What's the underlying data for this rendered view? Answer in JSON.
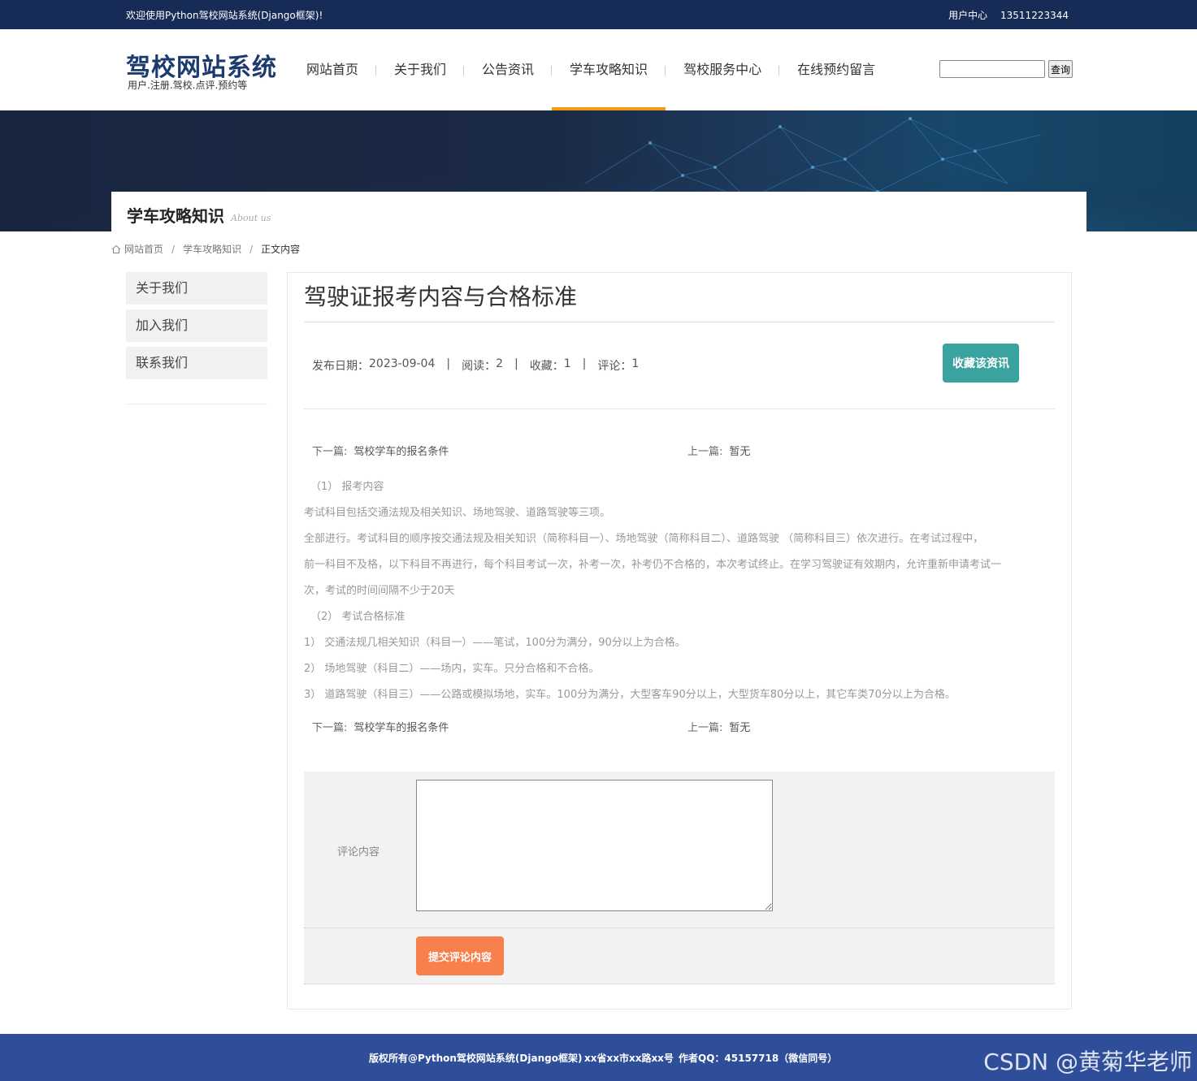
{
  "topbar": {
    "welcome": "欢迎使用Python驾校网站系统(Django框架)!",
    "user_center": "用户中心",
    "phone": "13511223344"
  },
  "header": {
    "logo_title": "驾校网站系统",
    "logo_subtitle": "用户.注册.驾校.点评.预约等",
    "nav": [
      "网站首页",
      "关于我们",
      "公告资讯",
      "学车攻略知识",
      "驾校服务中心",
      "在线预约留言"
    ],
    "active_nav": "学车攻略知识",
    "search_placeholder": "",
    "search_button": "查询"
  },
  "banner": {
    "title": "学车攻略知识",
    "subtitle": "About us"
  },
  "breadcrumb": {
    "home": "网站首页",
    "section": "学车攻略知识",
    "current": "正文内容"
  },
  "sidebar": {
    "items": [
      "关于我们",
      "加入我们",
      "联系我们"
    ]
  },
  "article": {
    "title": "驾驶证报考内容与合格标准",
    "date_label": "发布日期：",
    "date": "2023-09-04",
    "reads_label": "阅读：",
    "reads": "2",
    "favs_label": "收藏：",
    "favs": "1",
    "comments_label": "评论：",
    "comments": "1",
    "fav_button": "收藏该资讯",
    "next_label": "下一篇:",
    "next_title": "驾校学车的报名条件",
    "prev_label": "上一篇:",
    "prev_title": "暂无",
    "paragraphs": [
      "（1） 报考内容",
      "考试科目包括交通法规及相关知识、场地驾驶、道路驾驶等三项。",
      "全部进行。考试科目的顺序按交通法规及相关知识（简称科目一）、场地驾驶（简称科目二）、道路驾驶 （简称科目三）依次进行。在考试过程中，",
      "前一科目不及格，以下科目不再进行，每个科目考试一次，补考一次，补考仍不合格的，本次考试终止。在学习驾驶证有效期内，允许重新申请考试一",
      "次，考试的时间间隔不少于20天",
      "（2） 考试合格标准",
      "1） 交通法规几相关知识（科目一）——笔试，100分为满分，90分以上为合格。",
      "2） 场地驾驶（科目二）——场内，实车。只分合格和不合格。",
      "3） 道路驾驶（科目三）——公路或模拟场地，实车。100分为满分，大型客车90分以上，大型货车80分以上，其它车类70分以上为合格。"
    ]
  },
  "comment": {
    "label": "评论内容",
    "value": "",
    "submit": "提交评论内容"
  },
  "footer": {
    "copyright": "版权所有@Python驾校网站系统(Django框架)",
    "address": "xx省xx市xx路xx号",
    "qq": "作者QQ：45157718（微信同号）"
  },
  "watermark": "CSDN @黄菊华老师",
  "colors": {
    "topbar": "#172b57",
    "accent_nav": "#f39c12",
    "fav_button": "#3aa39f",
    "submit_button": "#f7804d",
    "footer": "#2f4e9a"
  }
}
